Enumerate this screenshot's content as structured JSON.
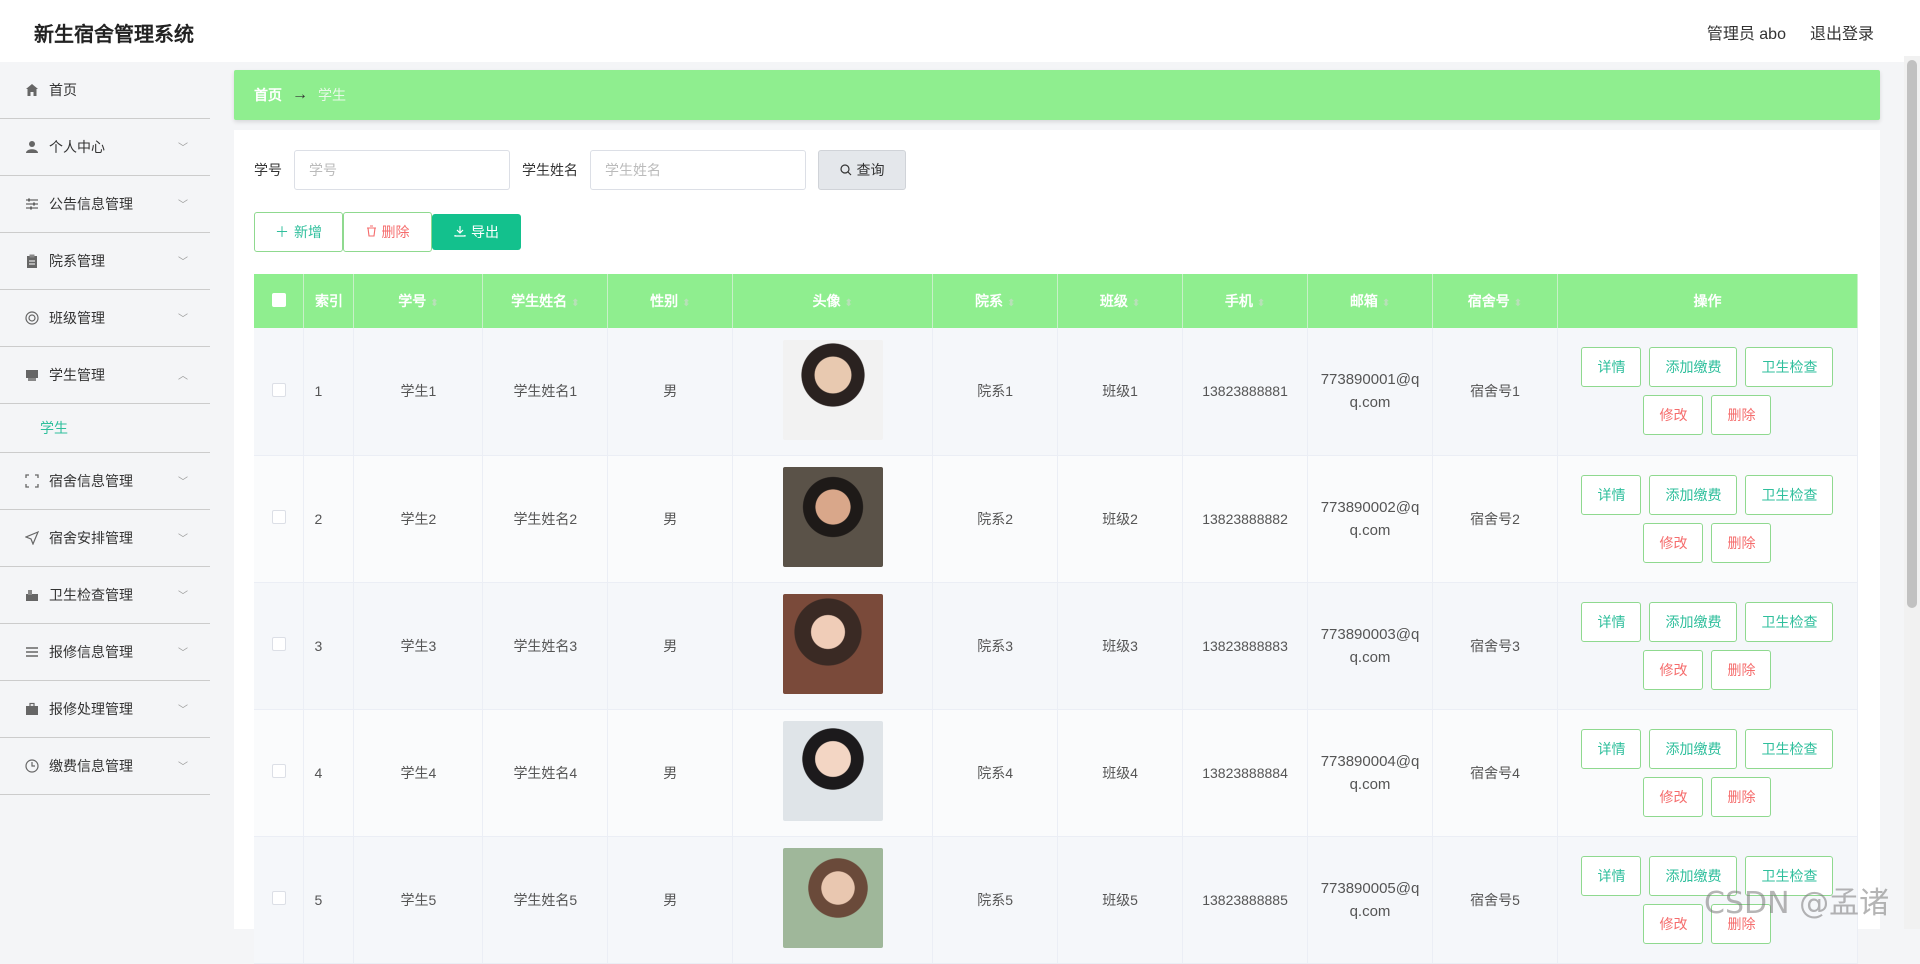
{
  "header": {
    "title": "新生宿舍管理系统",
    "user_label": "管理员 abo",
    "logout_label": "退出登录"
  },
  "sidebar": {
    "items": [
      {
        "label": "首页",
        "icon": "home-icon"
      },
      {
        "label": "个人中心",
        "icon": "user-icon"
      },
      {
        "label": "公告信息管理",
        "icon": "sliders-icon"
      },
      {
        "label": "院系管理",
        "icon": "clipboard-icon"
      },
      {
        "label": "班级管理",
        "icon": "target-icon"
      },
      {
        "label": "学生管理",
        "icon": "box-icon",
        "expanded": true
      },
      {
        "label": "宿舍信息管理",
        "icon": "fullscreen-icon"
      },
      {
        "label": "宿舍安排管理",
        "icon": "send-icon"
      },
      {
        "label": "卫生检查管理",
        "icon": "bucket-icon"
      },
      {
        "label": "报修信息管理",
        "icon": "list-icon"
      },
      {
        "label": "报修处理管理",
        "icon": "briefcase-icon"
      },
      {
        "label": "缴费信息管理",
        "icon": "clock-icon"
      }
    ],
    "submenu": {
      "label": "学生"
    }
  },
  "breadcrumb": {
    "home": "首页",
    "separator": "→",
    "current": "学生"
  },
  "search": {
    "student_no_label": "学号",
    "student_no_placeholder": "学号",
    "student_name_label": "学生姓名",
    "student_name_placeholder": "学生姓名",
    "query_label": "查询"
  },
  "actions": {
    "add_label": "新增",
    "delete_label": "删除",
    "export_label": "导出"
  },
  "table": {
    "columns": [
      "索引",
      "学号",
      "学生姓名",
      "性别",
      "头像",
      "院系",
      "班级",
      "手机",
      "邮箱",
      "宿舍号",
      "操作"
    ],
    "rows": [
      {
        "index": "1",
        "no": "学生1",
        "name": "学生姓名1",
        "gender": "男",
        "dept": "院系1",
        "class": "班级1",
        "phone": "13823888881",
        "email": "773890001@qq.com",
        "dorm": "宿舍号1"
      },
      {
        "index": "2",
        "no": "学生2",
        "name": "学生姓名2",
        "gender": "男",
        "dept": "院系2",
        "class": "班级2",
        "phone": "13823888882",
        "email": "773890002@qq.com",
        "dorm": "宿舍号2"
      },
      {
        "index": "3",
        "no": "学生3",
        "name": "学生姓名3",
        "gender": "男",
        "dept": "院系3",
        "class": "班级3",
        "phone": "13823888883",
        "email": "773890003@qq.com",
        "dorm": "宿舍号3"
      },
      {
        "index": "4",
        "no": "学生4",
        "name": "学生姓名4",
        "gender": "男",
        "dept": "院系4",
        "class": "班级4",
        "phone": "13823888884",
        "email": "773890004@qq.com",
        "dorm": "宿舍号4"
      },
      {
        "index": "5",
        "no": "学生5",
        "name": "学生姓名5",
        "gender": "男",
        "dept": "院系5",
        "class": "班级5",
        "phone": "13823888885",
        "email": "773890005@qq.com",
        "dorm": "宿舍号5"
      }
    ],
    "ops": {
      "info": "详情",
      "pay": "添加缴费",
      "check": "卫生检查",
      "edit": "修改",
      "delete": "删除"
    }
  },
  "watermark": "CSDN @孟诸",
  "colors": {
    "accent": "#8fee8f",
    "primary_text": "#2fbf9c",
    "danger": "#f56c6c",
    "export": "#13c18d"
  }
}
